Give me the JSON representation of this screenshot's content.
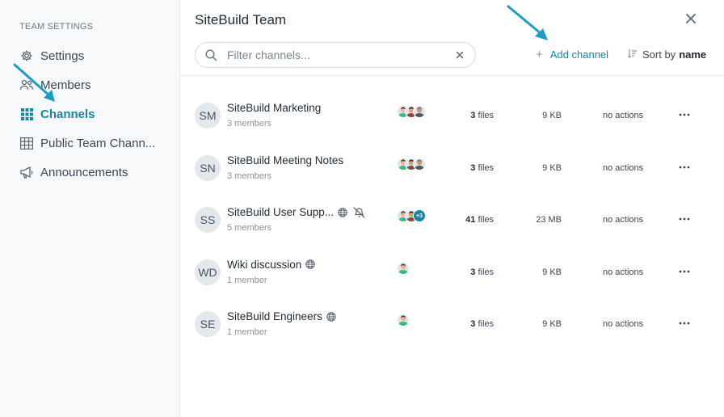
{
  "sidebar": {
    "heading": "TEAM SETTINGS",
    "items": [
      {
        "label": "Settings",
        "icon": "gear-icon",
        "active": false
      },
      {
        "label": "Members",
        "icon": "members-icon",
        "active": false
      },
      {
        "label": "Channels",
        "icon": "grid-icon",
        "active": true
      },
      {
        "label": "Public Team Chann...",
        "icon": "table-icon",
        "active": false
      },
      {
        "label": "Announcements",
        "icon": "megaphone-icon",
        "active": false
      }
    ]
  },
  "header": {
    "title": "SiteBuild Team"
  },
  "search": {
    "placeholder": "Filter channels...",
    "value": ""
  },
  "toolbar": {
    "add_label": "Add channel",
    "sort_label": "Sort by",
    "sort_value": "name"
  },
  "channels": [
    {
      "initials": "SM",
      "name": "SiteBuild Marketing",
      "members": "3 members",
      "public": false,
      "muted": false,
      "faces": 3,
      "extra": "",
      "files_count": "3",
      "files_label": "files",
      "size": "9 KB",
      "actions": "no actions"
    },
    {
      "initials": "SN",
      "name": "SiteBuild Meeting Notes",
      "members": "3 members",
      "public": false,
      "muted": false,
      "faces": 3,
      "extra": "",
      "files_count": "3",
      "files_label": "files",
      "size": "9 KB",
      "actions": "no actions"
    },
    {
      "initials": "SS",
      "name": "SiteBuild User Supp...",
      "members": "5 members",
      "public": true,
      "muted": true,
      "faces": 2,
      "extra": "+3",
      "files_count": "41",
      "files_label": "files",
      "size": "23 MB",
      "actions": "no actions"
    },
    {
      "initials": "WD",
      "name": "Wiki discussion",
      "members": "1 member",
      "public": true,
      "muted": false,
      "faces": 1,
      "extra": "",
      "files_count": "3",
      "files_label": "files",
      "size": "9 KB",
      "actions": "no actions"
    },
    {
      "initials": "SE",
      "name": "SiteBuild Engineers",
      "members": "1 member",
      "public": true,
      "muted": false,
      "faces": 1,
      "extra": "",
      "files_count": "3",
      "files_label": "files",
      "size": "9 KB",
      "actions": "no actions"
    }
  ],
  "colors": {
    "accent": "#0e8aa6",
    "arrow": "#1a9fc4"
  }
}
